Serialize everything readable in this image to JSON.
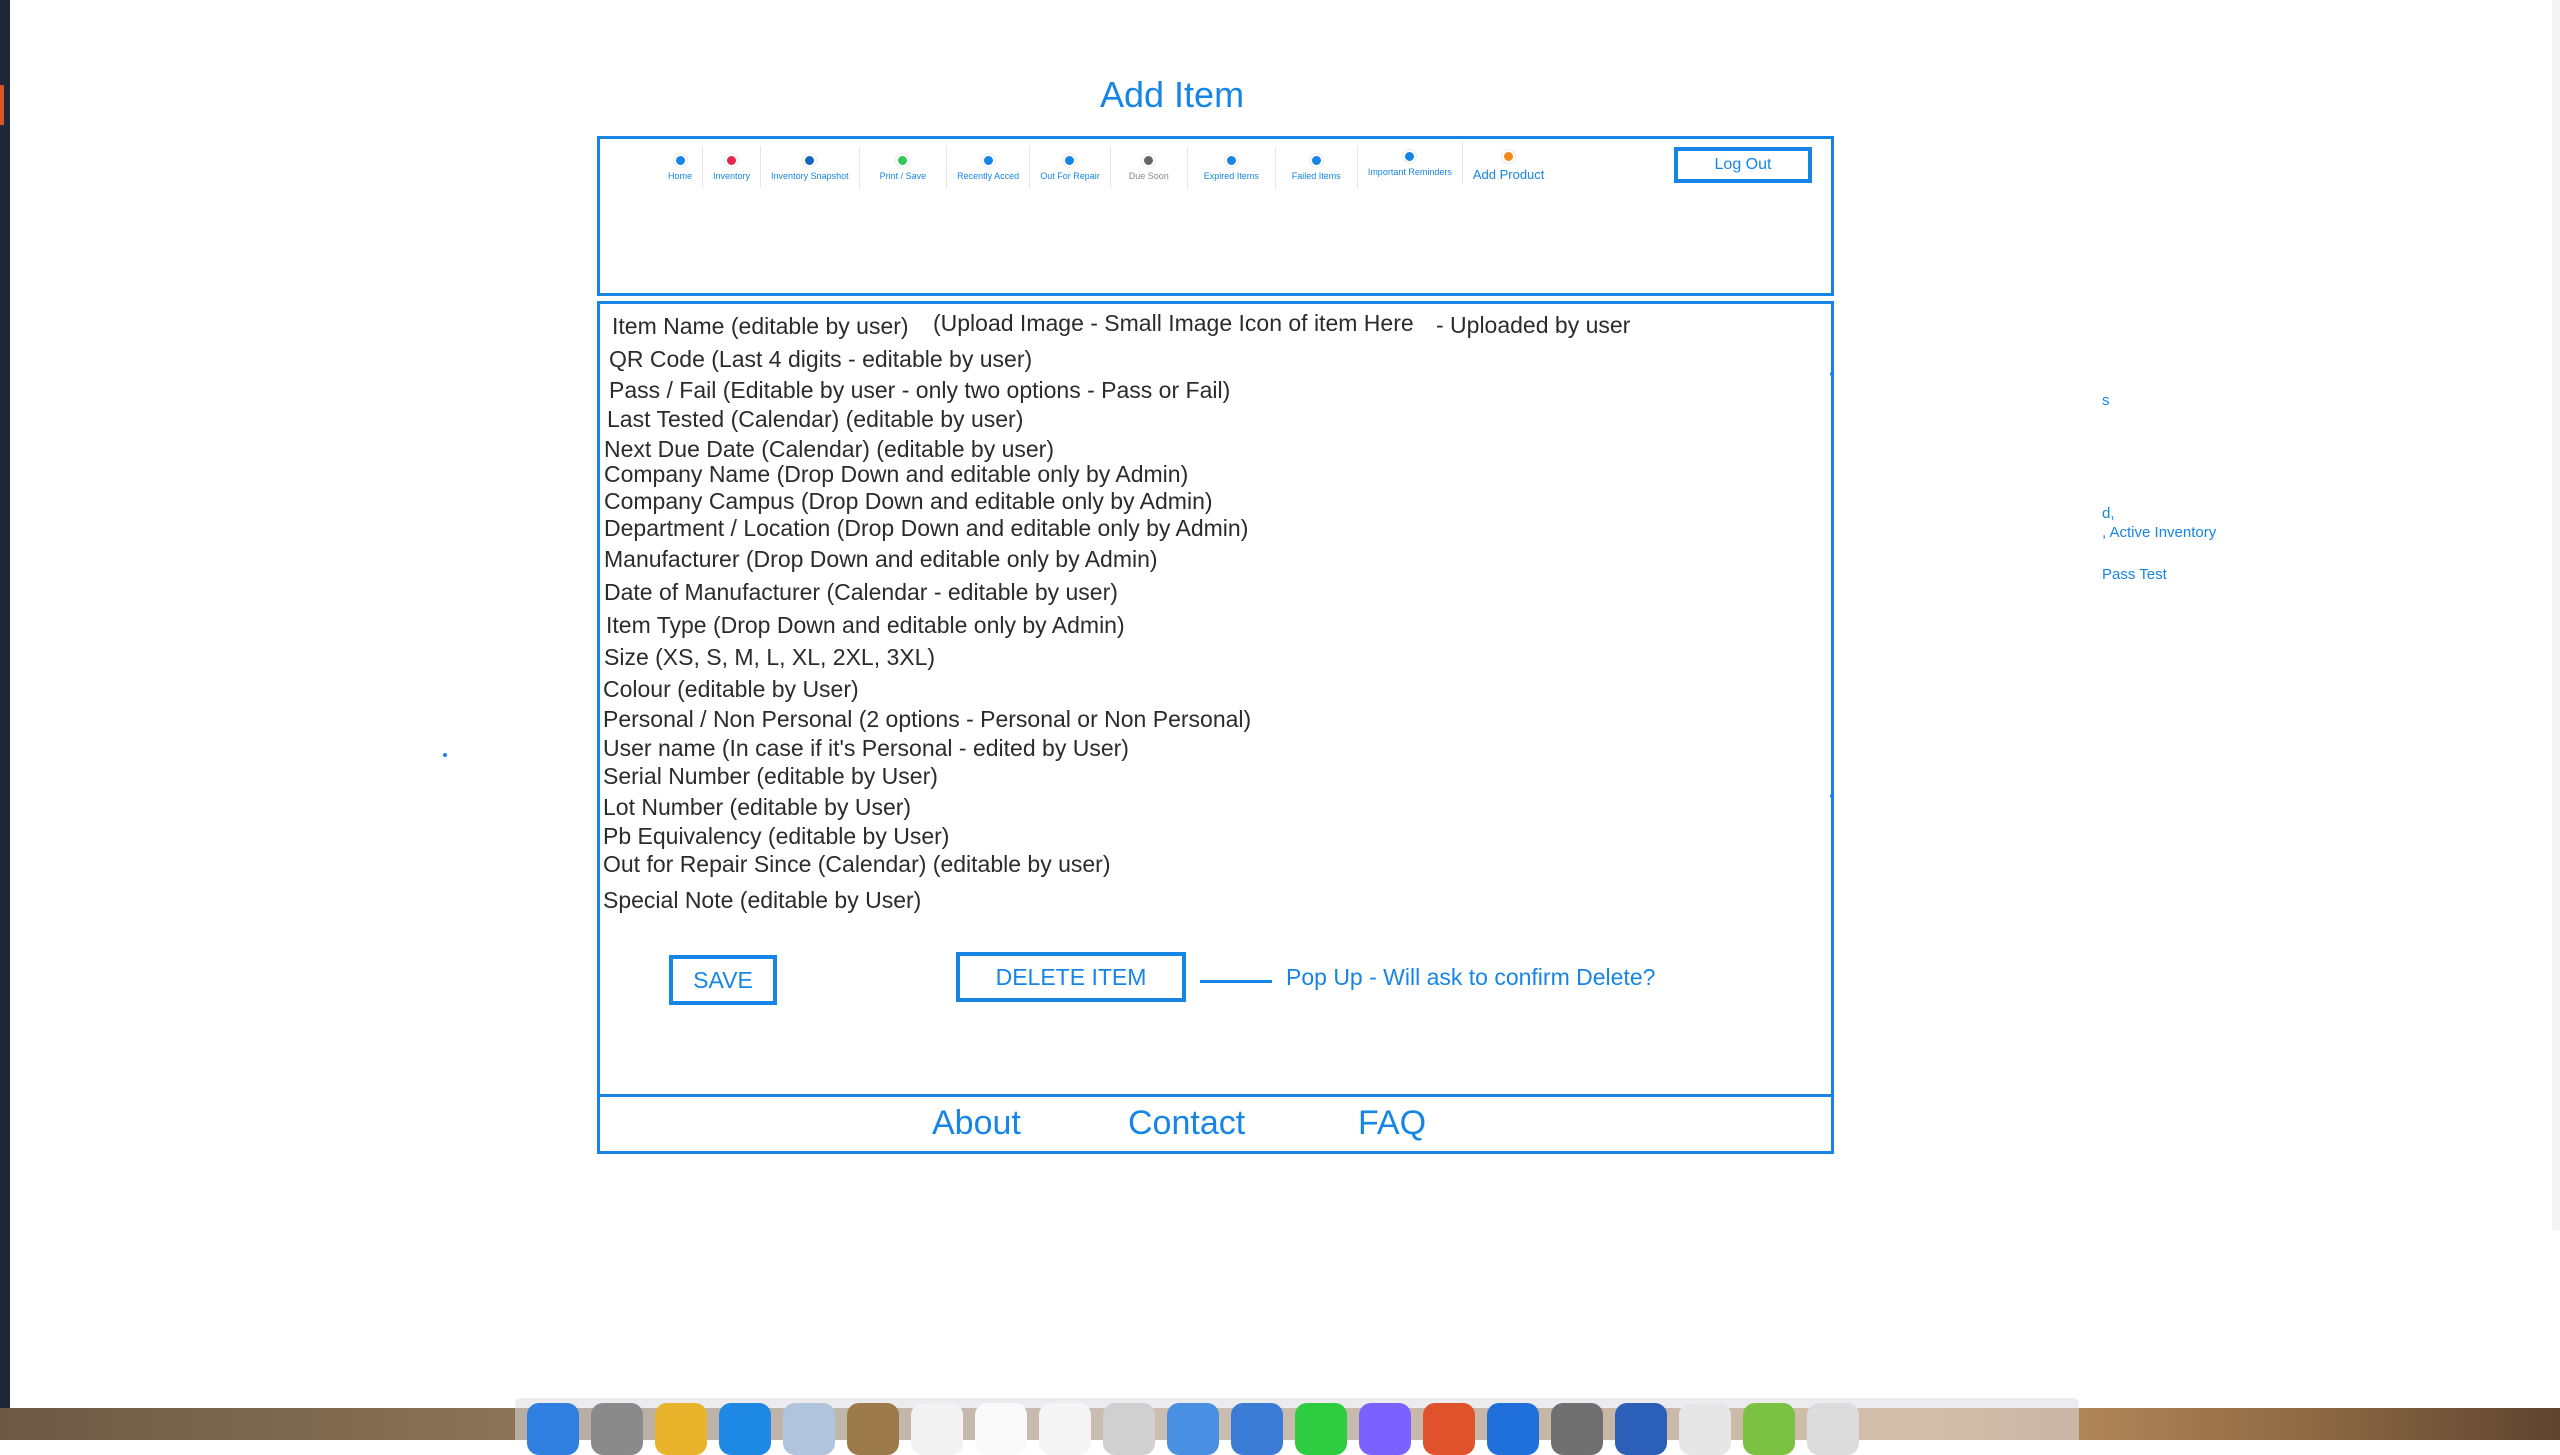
{
  "page_title": "Add Item",
  "nav": {
    "items": [
      {
        "label": "Home",
        "color": "#1685e6"
      },
      {
        "label": "Inventory",
        "color": "#e3264a"
      },
      {
        "label": "Inventory Snapshot",
        "color": "#1565c0"
      },
      {
        "label": "Print / Save",
        "color": "#34c759"
      },
      {
        "label": "Recently Acced",
        "color": "#1685e6"
      },
      {
        "label": "Out For Repair",
        "color": "#1685e6"
      },
      {
        "label": "Due Soon",
        "color": "#666666"
      },
      {
        "label": "Expired Items",
        "color": "#1685e6"
      },
      {
        "label": "Failed Items",
        "color": "#1685e6"
      },
      {
        "label": "Important Reminders",
        "color": "#1685e6"
      },
      {
        "label": "Add Product",
        "color": "#f28a16"
      }
    ],
    "logout_label": "Log Out"
  },
  "form": {
    "item_name": "Item Name (editable by user)",
    "upload_image": "(Upload Image - Small Image Icon of item Here",
    "uploaded_by": "- Uploaded by user",
    "fields": [
      "QR Code (Last 4 digits - editable by user)",
      "Pass / Fail  (Editable by user - only two options - Pass or Fail)",
      "Last Tested (Calendar) (editable by user)",
      "Next Due Date (Calendar) (editable by user)",
      "Company Name (Drop Down and editable only by Admin)",
      "Company Campus (Drop Down and editable only by Admin)",
      "Department / Location (Drop Down and editable only by Admin)",
      "Manufacturer (Drop Down and editable only by Admin)",
      "Date of Manufacturer (Calendar - editable by user)",
      "Item Type (Drop Down and editable only by Admin)",
      "Size (XS, S, M, L, XL, 2XL, 3XL)",
      "Colour (editable by User)",
      "Personal / Non Personal (2 options - Personal or Non Personal)",
      "User name (In case if it's Personal - edited by User)",
      "Serial Number (editable  by User)",
      "Lot Number (editable by User)",
      "Pb Equivalency (editable by User)",
      "Out for Repair Since (Calendar) (editable by user)",
      "Special Note (editable by User)"
    ],
    "save_label": "SAVE",
    "delete_label": "DELETE ITEM",
    "popup_note": "Pop Up - Will ask to confirm Delete?"
  },
  "footer": {
    "about": "About",
    "contact": "Contact",
    "faq": "FAQ"
  },
  "side_notes": [
    "s",
    "d,",
    ", Active Inventory",
    "Pass Test"
  ]
}
